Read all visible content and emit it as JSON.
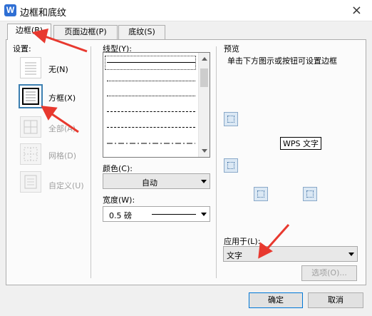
{
  "window": {
    "title": "边框和底纹",
    "close_glyph": "×",
    "app_icon_glyph": "W"
  },
  "tabs": [
    {
      "label": "边框(B)",
      "active": true
    },
    {
      "label": "页面边框(P)",
      "active": false
    },
    {
      "label": "底纹(S)",
      "active": false
    }
  ],
  "settings": {
    "header": "设置:",
    "items": [
      {
        "label": "无(N)",
        "enabled": true,
        "selected": false
      },
      {
        "label": "方框(X)",
        "enabled": true,
        "selected": true
      },
      {
        "label": "全部(A)",
        "enabled": false,
        "selected": false
      },
      {
        "label": "网格(D)",
        "enabled": false,
        "selected": false
      },
      {
        "label": "自定义(U)",
        "enabled": false,
        "selected": false
      }
    ]
  },
  "line_style": {
    "header": "线型(Y):",
    "styles": [
      "solid",
      "dotted",
      "dotted",
      "dashed",
      "dashed",
      "dash-dot",
      "dash-dot-dot"
    ]
  },
  "color": {
    "label": "颜色(C):",
    "value": "自动"
  },
  "width": {
    "label": "宽度(W):",
    "value": "0.5  磅"
  },
  "preview": {
    "header": "预览",
    "hint": "单击下方图示或按钮可设置边框",
    "sample_text": "WPS 文字"
  },
  "apply_to": {
    "label": "应用于(L):",
    "value": "文字"
  },
  "buttons": {
    "options": "选项(O)...",
    "ok": "确定",
    "cancel": "取消"
  },
  "colors": {
    "annotation_arrow": "#e8392f",
    "selection_border": "#3c7fb1"
  },
  "icons": [
    "word-app-icon",
    "close-icon",
    "border-top-icon",
    "border-bottom-icon",
    "border-left-icon",
    "border-right-icon"
  ]
}
